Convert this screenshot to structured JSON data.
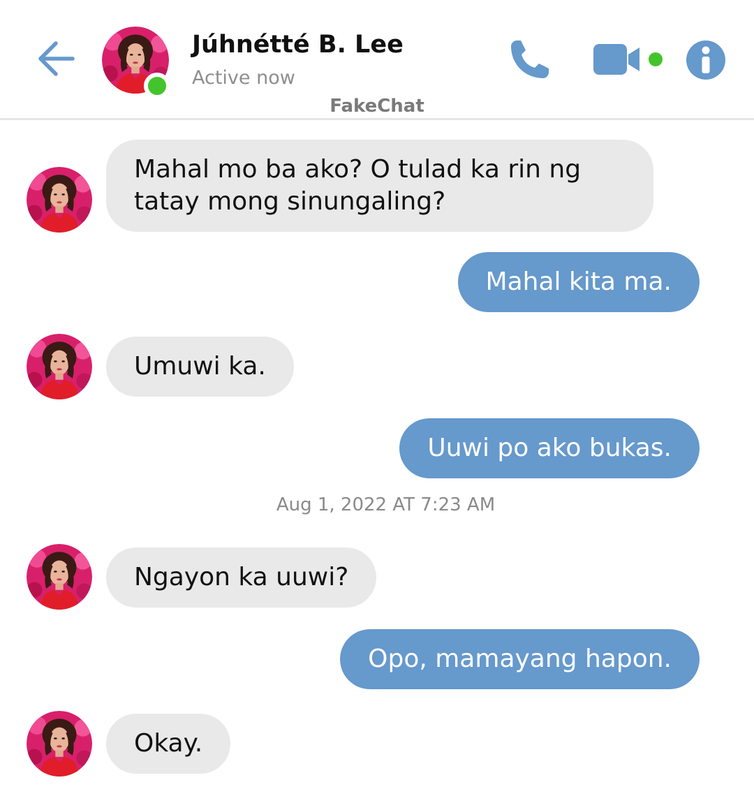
{
  "header": {
    "contact_name": "Júhnétté B. Lee",
    "status": "Active now",
    "app_name": "FakeChat",
    "online_color": "#44c42c",
    "accent_color": "#6699cc",
    "icons": [
      "back-arrow-icon",
      "phone-icon",
      "video-camera-icon",
      "info-icon"
    ]
  },
  "messages": [
    {
      "sender": "contact",
      "text": "Mahal mo ba ako? O tulad ka rin ng tatay mong sinungaling?"
    },
    {
      "sender": "me",
      "text": "Mahal kita ma."
    },
    {
      "sender": "contact",
      "text": "Umuwi ka."
    },
    {
      "sender": "me",
      "text": "Uuwi po ako bukas."
    },
    {
      "sender": "contact",
      "text": "Ngayon ka uuwi?"
    },
    {
      "sender": "me",
      "text": "Opo, mamayang hapon."
    },
    {
      "sender": "contact",
      "text": "Okay."
    }
  ],
  "timestamp": "Aug 1, 2022 AT 7:23 AM",
  "colors": {
    "incoming_bubble": "#e9e9e9",
    "outgoing_bubble": "#6699cc"
  }
}
